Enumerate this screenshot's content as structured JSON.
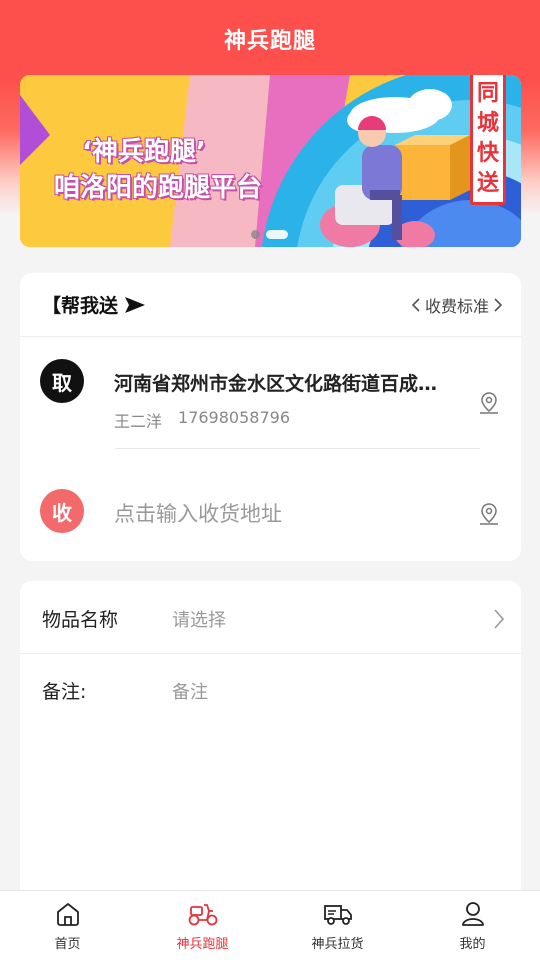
{
  "header": {
    "title": "神兵跑腿"
  },
  "banner": {
    "line1": "‘神兵跑腿’",
    "line2": "咱洛阳的跑腿平台",
    "stamp": [
      "同",
      "城",
      "快",
      "送"
    ]
  },
  "send_card": {
    "title": "【帮我送",
    "fee_label": "收费标准",
    "pickup": {
      "badge": "取",
      "address": "河南省郑州市金水区文化路街道百成…",
      "contact_name": "王二洋",
      "contact_phone": "17698058796"
    },
    "receive": {
      "badge": "收",
      "placeholder": "点击输入收货地址"
    }
  },
  "item_card": {
    "item_name_label": "物品名称",
    "item_name_placeholder": "请选择",
    "note_label": "备注:",
    "note_placeholder": "备注"
  },
  "tabbar": {
    "tabs": [
      {
        "label": "首页",
        "icon": "home-icon",
        "active": false
      },
      {
        "label": "神兵跑腿",
        "icon": "scooter-icon",
        "active": true
      },
      {
        "label": "神兵拉货",
        "icon": "truck-icon",
        "active": false
      },
      {
        "label": "我的",
        "icon": "user-icon",
        "active": false
      }
    ]
  },
  "colors": {
    "brand": "#fd4f4c",
    "active_tab": "#e8333a",
    "receive_badge": "#f26a6c"
  }
}
